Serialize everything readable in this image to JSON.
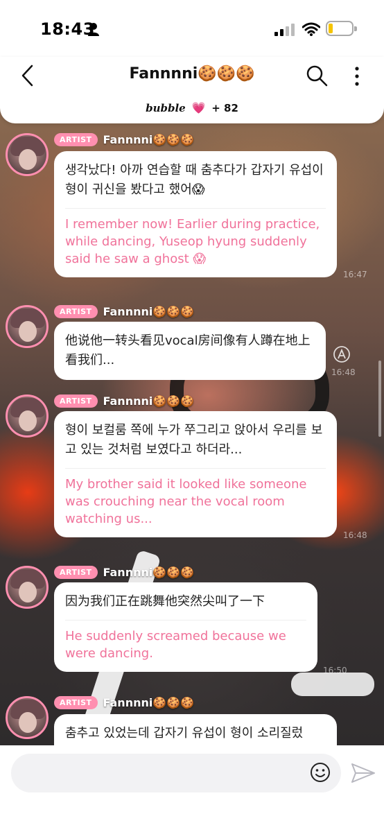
{
  "status": {
    "time": "18:43"
  },
  "header": {
    "title": "Fannnni🍪🍪🍪",
    "bubble_logo": "bubble",
    "heart": "💗",
    "count": "+ 82"
  },
  "messages": [
    {
      "badge": "ARTIST",
      "name": "Fannnni🍪🍪🍪",
      "original": "생각났다! 아까 연습할 때 춤추다가 갑자기 유섭이 형이 귀신을 봤다고 했어😱",
      "translation": "I remember now! Earlier during practice, while dancing, Yuseop hyung suddenly said he saw a ghost 😱",
      "time": "16:47"
    },
    {
      "badge": "ARTIST",
      "name": "Fannnni🍪🍪🍪",
      "original": "他说他一转头看见vocal房间像有人蹲在地上看我们...",
      "translation": "",
      "time": "16:48"
    },
    {
      "badge": "ARTIST",
      "name": "Fannnni🍪🍪🍪",
      "original": "형이 보컬룸 쪽에 누가 쭈그리고 앉아서 우리를 보고 있는 것처럼 보였다고 하더라...",
      "translation": "My brother said it looked like someone was crouching near the vocal room watching us...",
      "time": "16:48"
    },
    {
      "badge": "ARTIST",
      "name": "Fannnni🍪🍪🍪",
      "original": "因为我们正在跳舞他突然尖叫了一下",
      "translation": "He suddenly screamed because we were dancing.",
      "time": "16:50"
    },
    {
      "badge": "ARTIST",
      "name": "Fannnni🍪🍪🍪",
      "original": "춤추고 있었는데 갑자기 유섭이 형이 소리질렀",
      "translation": "",
      "time": ""
    }
  ],
  "icons": {
    "back": "chevron-left-icon",
    "search": "search-icon",
    "more": "more-vertical-icon",
    "emoji": "smiley-icon",
    "send": "paper-plane-icon",
    "translate": "translate-icon"
  },
  "colors": {
    "accent_pink": "#ff8fb0",
    "translation_pink": "#f0729a"
  }
}
